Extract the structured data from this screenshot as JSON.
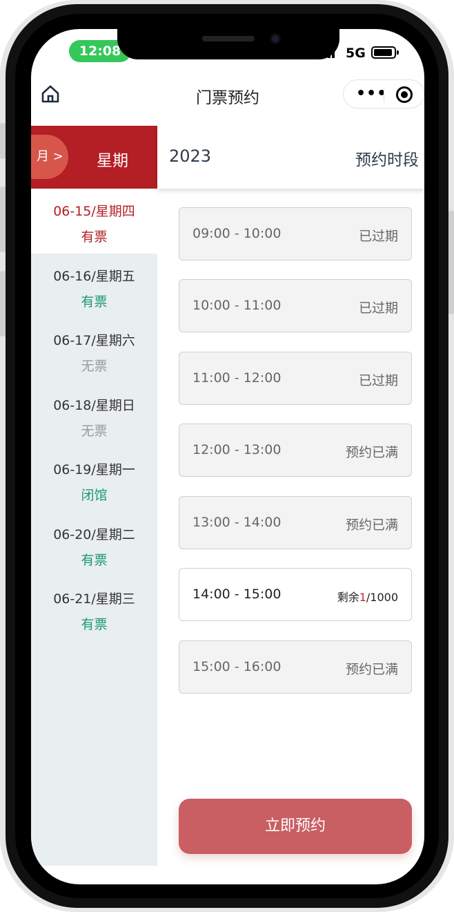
{
  "status_bar": {
    "time": "12:08",
    "network": "5G"
  },
  "nav": {
    "title": "门票预约",
    "more_label": "•••"
  },
  "header": {
    "month_label": "月 >",
    "week_label": "星期",
    "year": "2023",
    "slot_header": "预约时段"
  },
  "dates": [
    {
      "date": "06-15/星期四",
      "status": "有票"
    },
    {
      "date": "06-16/星期五",
      "status": "有票"
    },
    {
      "date": "06-17/星期六",
      "status": "无票"
    },
    {
      "date": "06-18/星期日",
      "status": "无票"
    },
    {
      "date": "06-19/星期一",
      "status": "闭馆"
    },
    {
      "date": "06-20/星期二",
      "status": "有票"
    },
    {
      "date": "06-21/星期三",
      "status": "有票"
    }
  ],
  "slots": [
    {
      "time": "09:00 - 10:00",
      "status": "已过期"
    },
    {
      "time": "10:00 - 11:00",
      "status": "已过期"
    },
    {
      "time": "11:00 - 12:00",
      "status": "已过期"
    },
    {
      "time": "12:00 - 13:00",
      "status": "预约已满"
    },
    {
      "time": "13:00 - 14:00",
      "status": "预约已满"
    },
    {
      "time": "14:00 - 15:00",
      "remaining_prefix": "剩余",
      "remaining": "1",
      "capacity": "/1000"
    },
    {
      "time": "15:00 - 16:00",
      "status": "预约已满"
    }
  ],
  "reserve_button": "立即预约",
  "colors": {
    "brand_red": "#b41e25",
    "available_green": "#1a9a6c",
    "unavailable_gray": "#999999",
    "button": "#c95e63"
  }
}
